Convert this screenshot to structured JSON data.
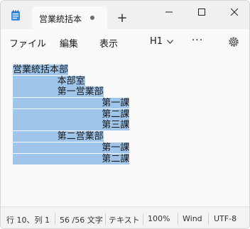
{
  "tab": {
    "title": "営業統括本"
  },
  "window_controls": {
    "new_tab": "+",
    "minimize": "minimize",
    "maximize": "maximize",
    "close": "close"
  },
  "menu": {
    "file": "ファイル",
    "edit": "編集",
    "view": "表示",
    "heading": "H1",
    "more": "···"
  },
  "editor": {
    "lines": [
      "営業統括本部",
      "        本部室",
      "        第一営業部",
      "                第一課",
      "                第二課",
      "                第三課",
      "        第二営業部",
      "                第一課",
      "                第二課"
    ]
  },
  "status": {
    "position": "行 10、列 1",
    "chars": "56 /56 文字",
    "format": "テキスト",
    "zoom": "100%",
    "eol": "Wind",
    "encoding": "UTF-8"
  },
  "colors": {
    "selection": "#9fc5ea",
    "background": "#f9f9f9"
  }
}
